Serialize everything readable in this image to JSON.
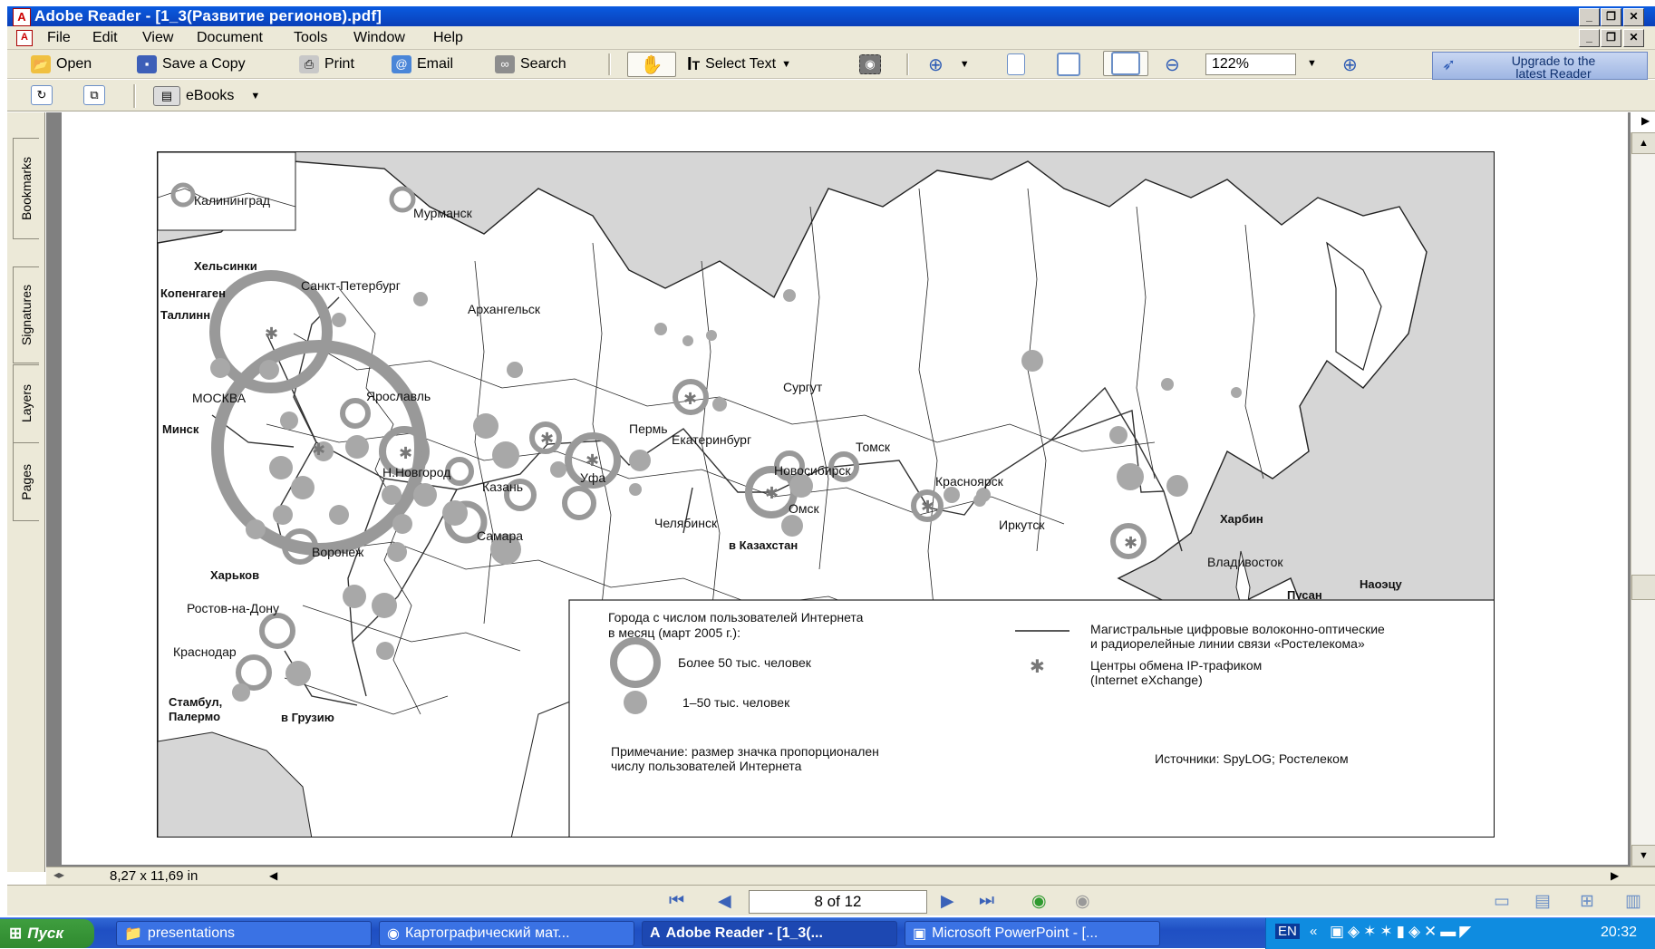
{
  "window": {
    "title": "Adobe Reader - [1_3(Развитие регионов).pdf]",
    "controls": [
      "_",
      "❐",
      "✕"
    ]
  },
  "menu": [
    "File",
    "Edit",
    "View",
    "Document",
    "Tools",
    "Window",
    "Help"
  ],
  "toolbar": {
    "open": "Open",
    "save_copy": "Save a Copy",
    "print": "Print",
    "email": "Email",
    "search": "Search",
    "select_text": "Select Text",
    "zoom": "122%",
    "upgrade_line1": "Upgrade to the",
    "upgrade_line2": "latest Reader",
    "ebooks": "eBooks"
  },
  "nav_tabs": [
    "Bookmarks",
    "Signatures",
    "Layers",
    "Pages"
  ],
  "map": {
    "cities": {
      "kaliningrad": "Калининград",
      "murmansk": "Мурманск",
      "helsinki": "Хельсинки",
      "copenhagen": "Копенгаген",
      "tallinn": "Таллинн",
      "spb": "Санкт-Петербург",
      "arkhangelsk": "Архангельск",
      "moscow": "МОСКВА",
      "yaroslavl": "Ярославль",
      "minsk": "Минск",
      "nnovgorod": "Н.Новгород",
      "kazan": "Казань",
      "perm": "Пермь",
      "yekaterinburg": "Екатеринбург",
      "surgut": "Сургут",
      "ufa": "Уфа",
      "tomsk": "Томск",
      "novosibirsk": "Новосибирск",
      "krasnoyarsk": "Красноярск",
      "omsk": "Омск",
      "chelyabinsk": "Челябинск",
      "samara": "Самара",
      "kazakhstan": "в Казахстан",
      "irkutsk": "Иркутск",
      "harbin": "Харбин",
      "vladivostok": "Владивосток",
      "naoetsu": "Наоэцу",
      "busan": "Пусан",
      "voronezh": "Воронеж",
      "kharkov": "Харьков",
      "rostov": "Ростов-на-Дону",
      "krasnodar": "Краснодар",
      "istanbul1": "Стамбул,",
      "istanbul2": "Палермо",
      "georgia": "в Грузию"
    },
    "legend": {
      "title1": "Города с числом пользователей Интернета",
      "title2": "в месяц (март 2005 г.):",
      "big": "Более 50 тыс. человек",
      "small": "1–50 тыс. человек",
      "note1": "Примечание: размер значка пропорционален",
      "note2": "числу пользователей Интернета",
      "lines1": "Магистральные цифровые волоконно-оптические",
      "lines2": "и радиорелейные линии связи «Ростелекома»",
      "ix1": "Центры обмена IP-трафиком",
      "ix2": "(Internet  eXchange)",
      "sources": "Источники: SpyLOG; Ростелеком"
    }
  },
  "status": {
    "page_size": "8,27 x 11,69 in",
    "page_indicator": "8 of 12"
  },
  "taskbar": {
    "start": "Пуск",
    "tasks": [
      "presentations",
      "Картографический мат...",
      "Adobe Reader - [1_3(...",
      "Microsoft PowerPoint - [..."
    ],
    "lang": "EN",
    "clock": "20:32"
  }
}
